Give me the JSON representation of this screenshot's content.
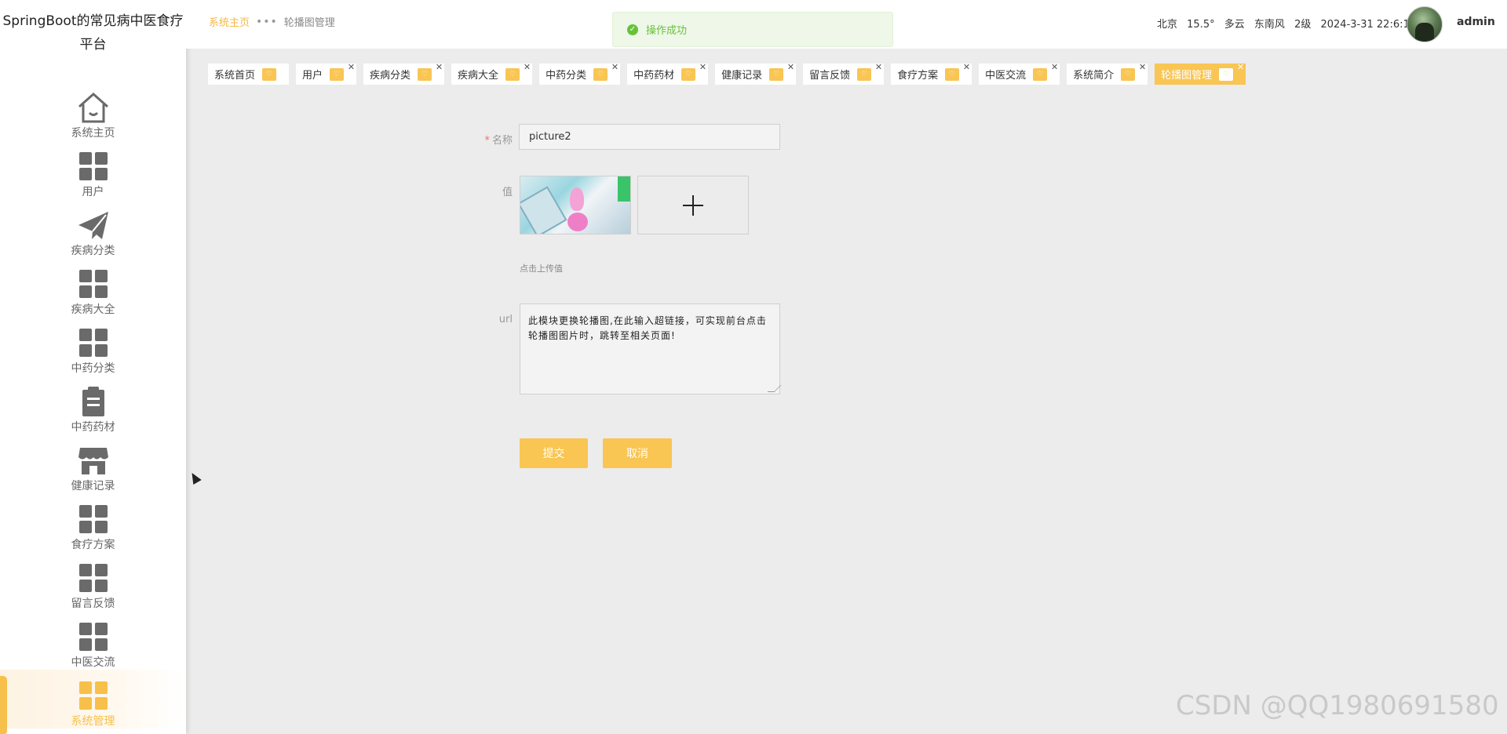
{
  "app": {
    "title": "SpringBoot的常见病中医食疗平台"
  },
  "sidebar": {
    "items": [
      {
        "label": "系统主页",
        "icon": "home-icon"
      },
      {
        "label": "用户",
        "icon": "grid-icon"
      },
      {
        "label": "疾病分类",
        "icon": "paper-plane-icon"
      },
      {
        "label": "疾病大全",
        "icon": "grid-icon"
      },
      {
        "label": "中药分类",
        "icon": "grid-icon"
      },
      {
        "label": "中药药材",
        "icon": "clipboard-icon"
      },
      {
        "label": "健康记录",
        "icon": "store-icon"
      },
      {
        "label": "食疗方案",
        "icon": "grid-icon"
      },
      {
        "label": "留言反馈",
        "icon": "grid-icon"
      },
      {
        "label": "中医交流",
        "icon": "grid-icon"
      },
      {
        "label": "系统管理",
        "icon": "grid-icon",
        "active": true
      }
    ]
  },
  "header": {
    "breadcrumb": {
      "home": "系统主页",
      "separator": "•••",
      "current": "轮播图管理"
    },
    "toast": {
      "message": "操作成功",
      "icon": "check-circle-icon"
    },
    "weather": {
      "city": "北京",
      "temp": "15.5°",
      "condition": "多云",
      "wind": "东南风",
      "level": "2级",
      "datetime": "2024-3-31 22:6:17"
    },
    "user": {
      "name": "admin"
    }
  },
  "tabs": [
    {
      "label": "系统首页"
    },
    {
      "label": "用户"
    },
    {
      "label": "疾病分类"
    },
    {
      "label": "疾病大全"
    },
    {
      "label": "中药分类"
    },
    {
      "label": "中药药材"
    },
    {
      "label": "健康记录"
    },
    {
      "label": "留言反馈"
    },
    {
      "label": "食疗方案"
    },
    {
      "label": "中医交流"
    },
    {
      "label": "系统简介"
    },
    {
      "label": "轮播图管理",
      "active": true
    }
  ],
  "form": {
    "name_label": "名称",
    "name_required": "*",
    "name_value": "picture2",
    "value_label": "值",
    "upload_tip": "点击上传值",
    "url_label": "url",
    "url_value": "此模块更换轮播图,在此输入超链接，可实现前台点击轮播图图片时，跳转至相关页面!",
    "submit_label": "提交",
    "cancel_label": "取消"
  },
  "colors": {
    "accent": "#f9c553",
    "success": "#67c23a",
    "background": "#ececec"
  },
  "watermark": "CSDN @QQ1980691580"
}
